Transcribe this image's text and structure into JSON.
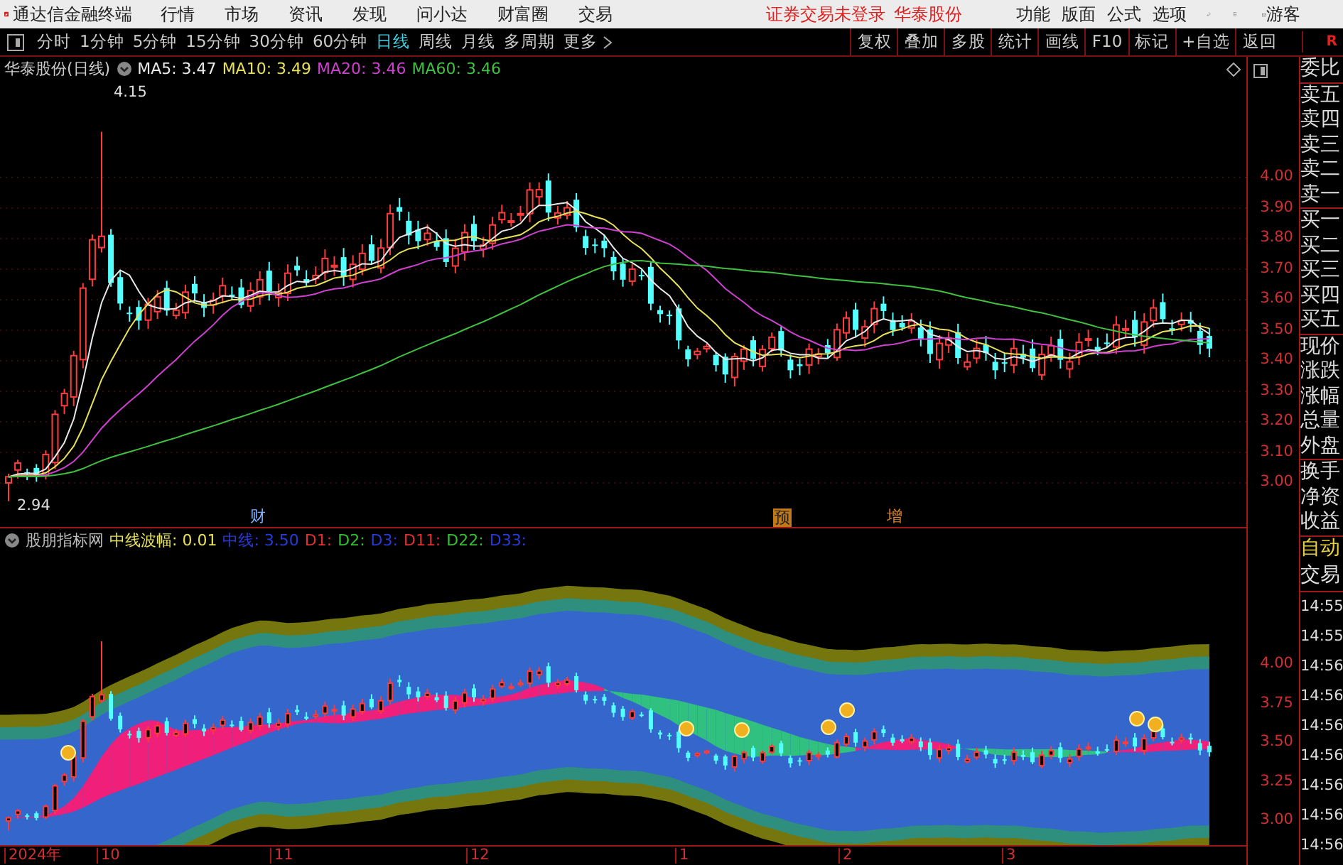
{
  "app": {
    "title": "通达信金融终端",
    "menus": [
      "行情",
      "市场",
      "资讯",
      "发现",
      "问小达",
      "财富圈",
      "交易"
    ],
    "login_status": "证券交易未登录",
    "stock_link": "华泰股份",
    "tools": [
      "功能",
      "版面",
      "公式",
      "选项"
    ],
    "user": "游客"
  },
  "toolbar": {
    "periods": [
      {
        "label": "分时",
        "selected": false
      },
      {
        "label": "1分钟",
        "selected": false
      },
      {
        "label": "5分钟",
        "selected": false
      },
      {
        "label": "15分钟",
        "selected": false
      },
      {
        "label": "30分钟",
        "selected": false
      },
      {
        "label": "60分钟",
        "selected": false
      },
      {
        "label": "日线",
        "selected": true
      },
      {
        "label": "周线",
        "selected": false
      },
      {
        "label": "月线",
        "selected": false
      },
      {
        "label": "多周期",
        "selected": false
      },
      {
        "label": "更多",
        "selected": false
      }
    ],
    "actions": [
      "复权",
      "叠加",
      "多股",
      "统计",
      "画线",
      "F10",
      "标记",
      "+自选",
      "返回"
    ],
    "flag": "R"
  },
  "main_chart": {
    "title": "华泰股份(日线)",
    "averages": [
      {
        "label": "MA5: 3.47",
        "color": "#e8e8e8"
      },
      {
        "label": "MA10: 3.49",
        "color": "#e6e05a"
      },
      {
        "label": "MA20: 3.46",
        "color": "#d040d0"
      },
      {
        "label": "MA60: 3.46",
        "color": "#40c040"
      }
    ],
    "high_label": "4.15",
    "low_label": "2.94",
    "markers": [
      {
        "label": "财",
        "kind": "plain"
      },
      {
        "label": "预",
        "kind": "boxed"
      },
      {
        "label": "增",
        "kind": "plain"
      }
    ],
    "y_labels": [
      "4.00",
      "3.90",
      "3.80",
      "3.70",
      "3.60",
      "3.50",
      "3.40",
      "3.30",
      "3.20",
      "3.10",
      "3.00"
    ]
  },
  "indicator": {
    "name": "股朋指标网",
    "values": [
      {
        "label": "中线波幅: 0.01",
        "color": "#e6e05a"
      },
      {
        "label": "中线: 3.50",
        "color": "#2a3ad8"
      },
      {
        "label": "D1:",
        "color": "#e03030"
      },
      {
        "label": "D2:",
        "color": "#30c030"
      },
      {
        "label": "D3:",
        "color": "#2a3ad8"
      },
      {
        "label": "D11:",
        "color": "#e03030"
      },
      {
        "label": "D22:",
        "color": "#30c030"
      },
      {
        "label": "D33:",
        "color": "#2a3ad8"
      }
    ],
    "y_labels": [
      "4.00",
      "3.75",
      "3.50",
      "3.25",
      "3.00"
    ]
  },
  "x_axis": {
    "labels": [
      "2024年",
      "10",
      "11",
      "12",
      "1",
      "2",
      "3"
    ]
  },
  "quote_panel": {
    "groups": [
      [
        "委比"
      ],
      [
        "卖五",
        "卖四",
        "卖三",
        "卖二",
        "卖一"
      ],
      [
        "买一",
        "买二",
        "买三",
        "买四",
        "买五"
      ],
      [
        "现价",
        "涨跌",
        "涨幅",
        "总量",
        "外盘"
      ],
      [
        "换手",
        "净资",
        "收益"
      ]
    ],
    "trade_labels": [
      {
        "label": "自动",
        "kind": "highlight"
      },
      {
        "label": "交易",
        "kind": "plain"
      }
    ],
    "times": [
      "14:55",
      "14:55",
      "14:56",
      "14:56",
      "14:56",
      "14:56",
      "14:56",
      "14:56",
      "14:56"
    ]
  }
}
